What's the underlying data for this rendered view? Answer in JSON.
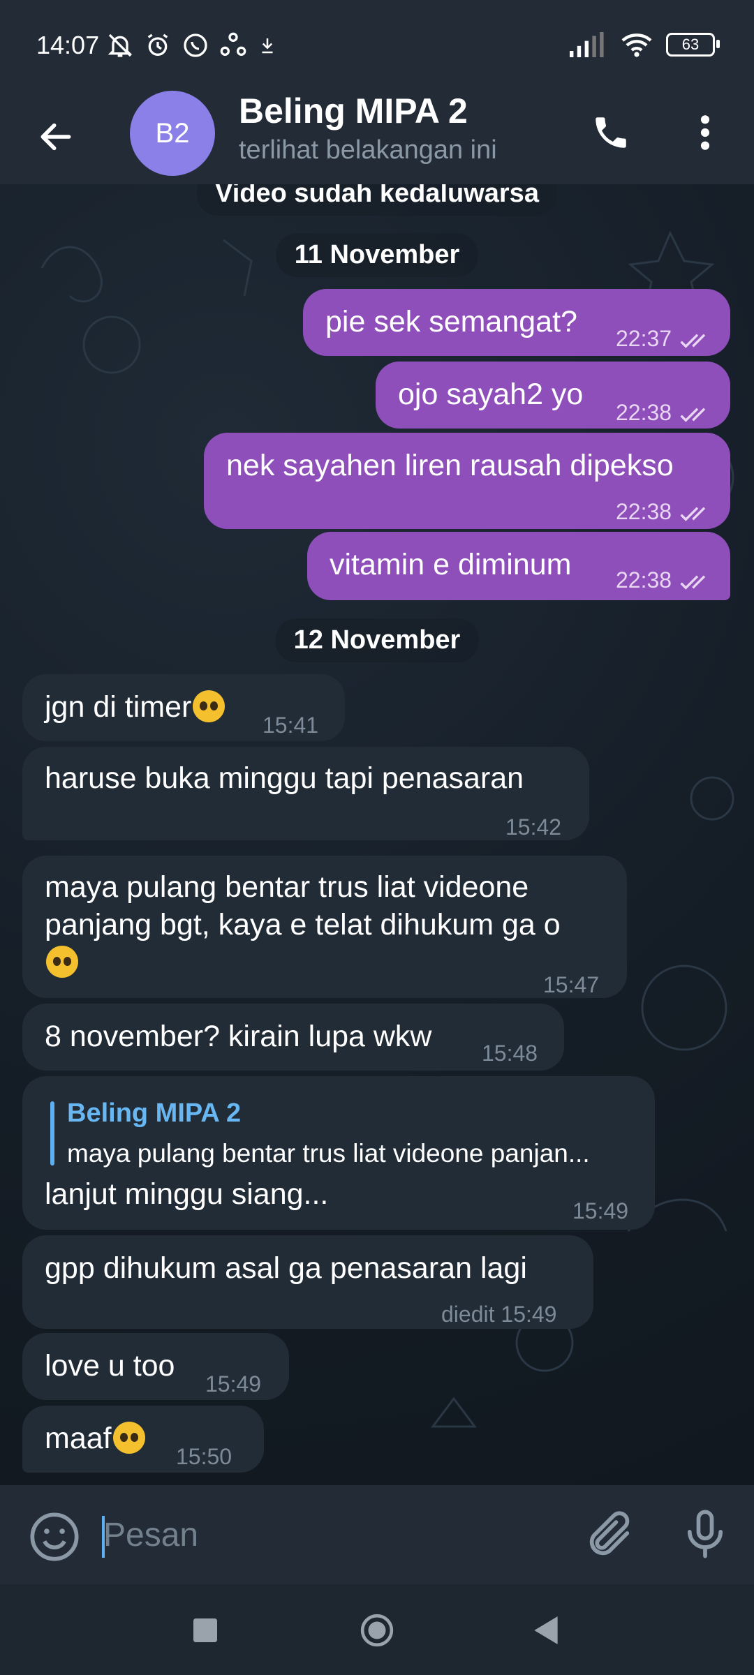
{
  "status": {
    "time": "14:07",
    "battery": "63"
  },
  "header": {
    "avatar_initials": "B2",
    "title": "Beling MIPA 2",
    "subtitle": "terlihat belakangan ini"
  },
  "chat": {
    "system_top": "Video sudah kedaluwarsa",
    "date1": "11 November",
    "out": [
      {
        "text": "pie sek semangat?",
        "time": "22:37"
      },
      {
        "text": "ojo sayah2 yo",
        "time": "22:38"
      },
      {
        "text": "nek sayahen liren rausah dipekso",
        "time": "22:38"
      },
      {
        "text": "vitamin e diminum",
        "time": "22:38"
      }
    ],
    "date2": "12 November",
    "in": [
      {
        "text": "jgn di timer",
        "time": "15:41"
      },
      {
        "text": "haruse buka minggu tapi penasaran",
        "time": "15:42"
      },
      {
        "text_line1": "maya pulang bentar trus liat videone",
        "text_line2": "panjang bgt, kaya e telat dihukum ga o",
        "time": "15:47"
      },
      {
        "text": "8 november? kirain lupa wkw",
        "time": "15:48"
      },
      {
        "reply_name": "Beling MIPA 2",
        "reply_text": "maya pulang bentar trus liat videone panjan...",
        "text": "lanjut minggu siang...",
        "time": "15:49"
      },
      {
        "text": "gpp dihukum asal ga penasaran lagi",
        "time": "diedit 15:49"
      },
      {
        "text": "love u too",
        "time": "15:49"
      },
      {
        "text": "maaf",
        "time": "15:50"
      }
    ]
  },
  "input": {
    "placeholder": "Pesan"
  },
  "icons": {
    "back": "arrow-left-icon",
    "call": "phone-icon",
    "menu": "more-vertical-icon",
    "emoji": "smiley-icon",
    "attach": "paperclip-icon",
    "mic": "microphone-icon",
    "read": "double-check-icon"
  },
  "colors": {
    "outgoing": "#8e4fba",
    "incoming": "#222c37",
    "accent": "#5fb0f0",
    "avatar": "#8a80e8"
  }
}
